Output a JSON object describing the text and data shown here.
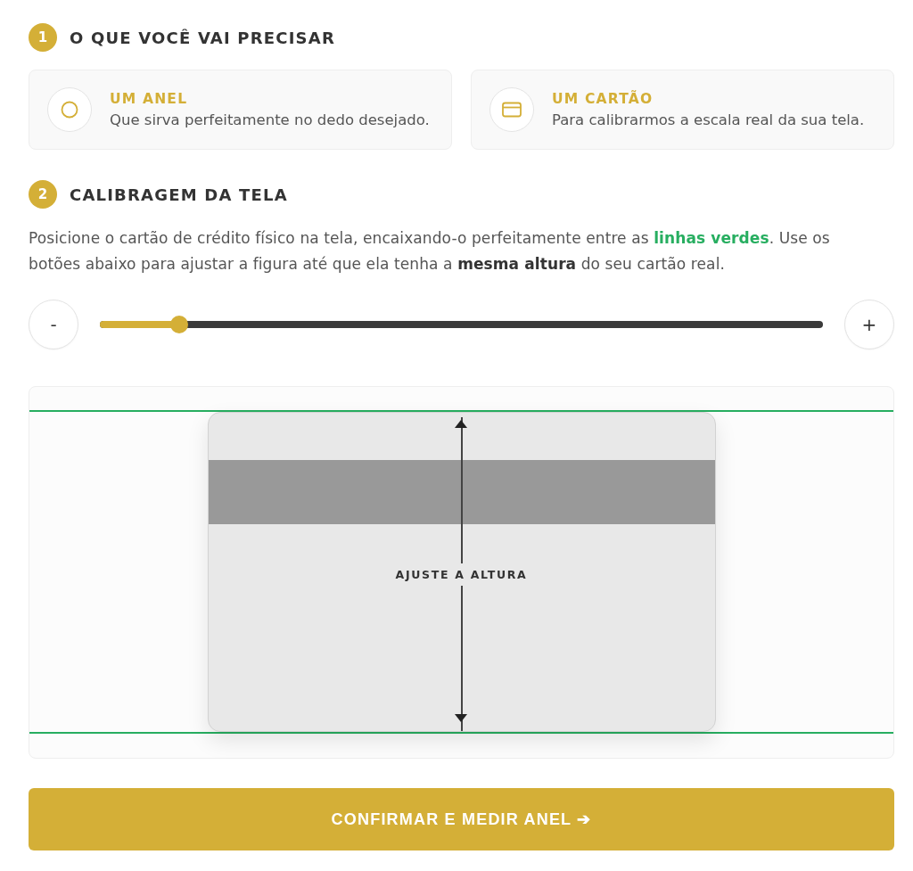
{
  "requirements_section": {
    "number": "1",
    "title": "O QUE VOCÊ VAI PRECISAR",
    "items": [
      {
        "kind": "ring",
        "title": "UM ANEL",
        "description": "Que sirva perfeitamente no dedo desejado."
      },
      {
        "kind": "card",
        "title": "UM CARTÃO",
        "description": "Para calibrarmos a escala real da sua tela."
      }
    ]
  },
  "calibration_section": {
    "number": "2",
    "title": "CALIBRAGEM DA TELA",
    "instructions": "Posicione o cartão de crédito físico na tela, encaixando-o perfeitamente entre as **linhas verdes**. Use os botões abaixo para ajustar a figura até que ela tenha a **mesma altura** do seu cartão real.",
    "decrease_button": "-",
    "increase_button": "+",
    "size_slider": {
      "level": 0.11
    },
    "card_preview": {
      "label": "AJUSTE A ALTURA"
    }
  },
  "confirm_button": "CONFIRMAR E MEDIR ANEL ➔"
}
